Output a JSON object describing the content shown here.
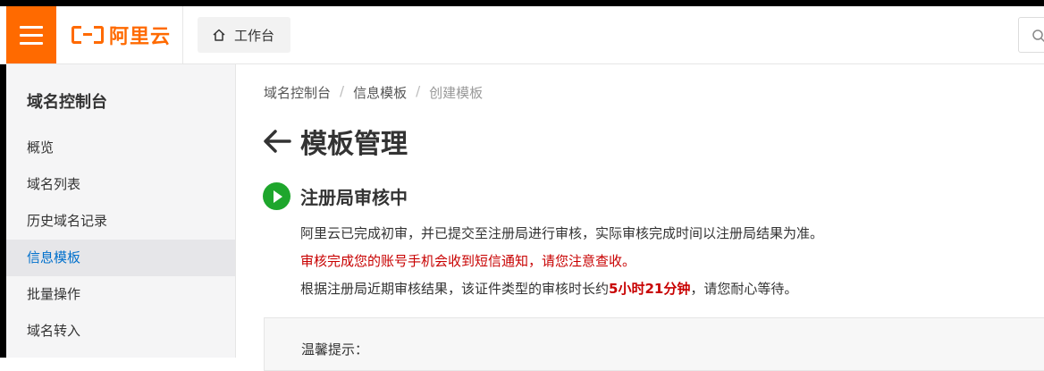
{
  "header": {
    "brand_text": "阿里云",
    "workbench_label": "工作台",
    "accent_color": "#ff6a00"
  },
  "sidebar": {
    "title": "域名控制台",
    "items": [
      {
        "label": "概览",
        "active": false
      },
      {
        "label": "域名列表",
        "active": false
      },
      {
        "label": "历史域名记录",
        "active": false
      },
      {
        "label": "信息模板",
        "active": true
      },
      {
        "label": "批量操作",
        "active": false
      },
      {
        "label": "域名转入",
        "active": false
      }
    ]
  },
  "breadcrumb": {
    "items": [
      "域名控制台",
      "信息模板",
      "创建模板"
    ],
    "separator": "/"
  },
  "page": {
    "title": "模板管理"
  },
  "status": {
    "title": "注册局审核中",
    "line1": "阿里云已完成初审，并已提交至注册局进行审核，实际审核完成时间以注册局结果为准。",
    "line2": "审核完成您的账号手机会收到短信通知，请您注意查收。",
    "line3_prefix": "根据注册局近期审核结果，该证件类型的审核时长约",
    "line3_highlight": "5小时21分钟",
    "line3_suffix": "，请您耐心等待。",
    "status_color": "#1ea62c",
    "warning_color": "#c80000"
  },
  "tips": {
    "title": "温馨提示："
  }
}
